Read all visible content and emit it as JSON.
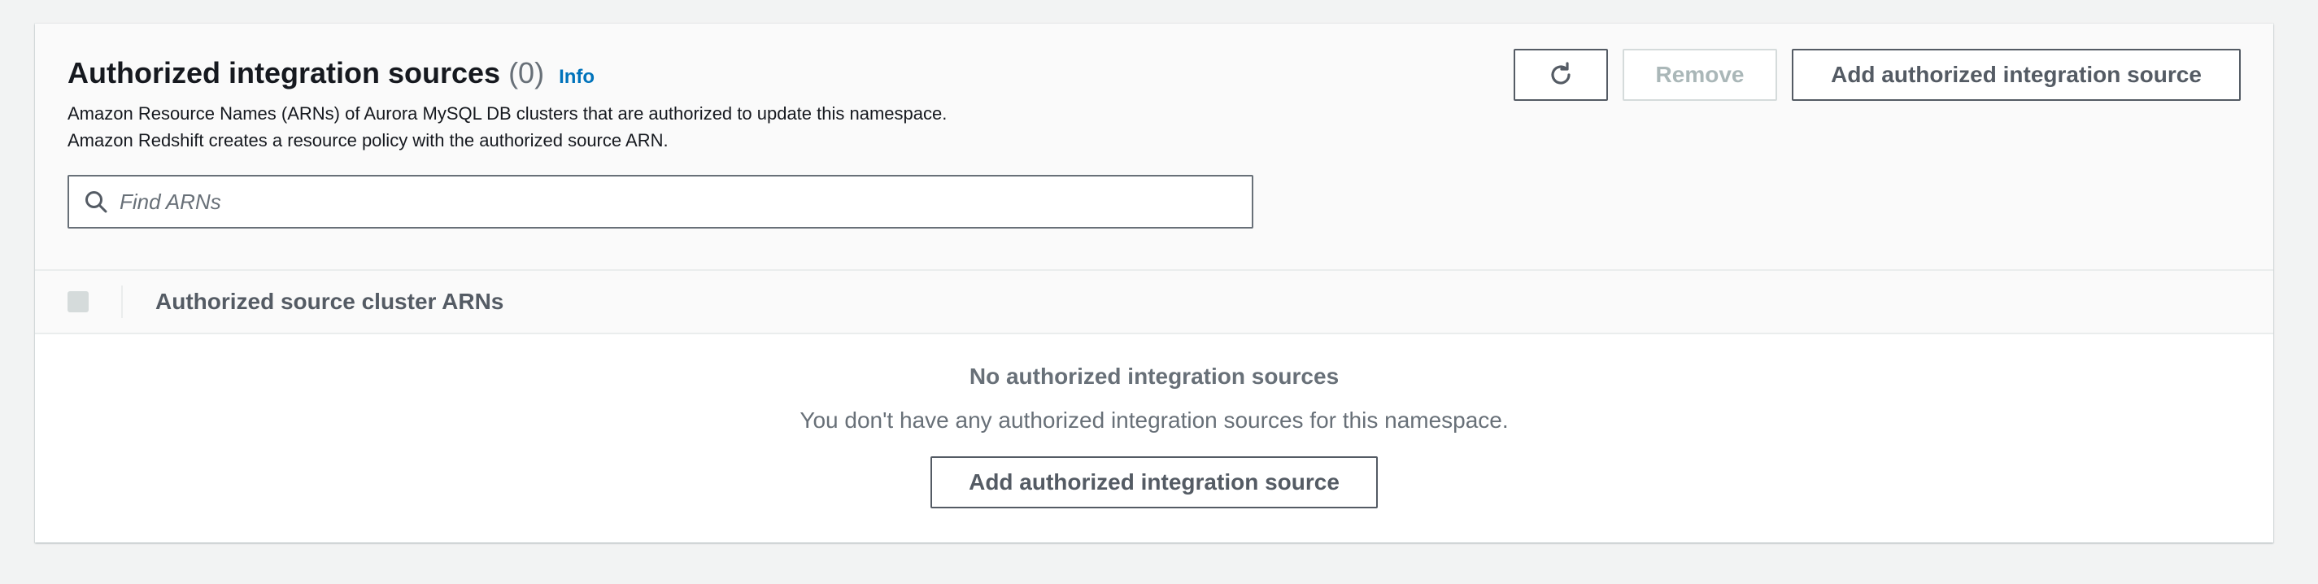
{
  "header": {
    "title": "Authorized integration sources",
    "count": "(0)",
    "info_link": "Info",
    "description_line1": "Amazon Resource Names (ARNs) of Aurora MySQL DB clusters that are authorized to update this namespace.",
    "description_line2": "Amazon Redshift creates a resource policy with the authorized source ARN."
  },
  "actions": {
    "refresh_icon": "refresh-icon",
    "remove_label": "Remove",
    "add_label": "Add authorized integration source"
  },
  "search": {
    "placeholder": "Find ARNs",
    "value": "",
    "icon": "search-icon"
  },
  "table": {
    "columns": [
      "Authorized source cluster ARNs"
    ],
    "rows": []
  },
  "empty_state": {
    "title": "No authorized integration sources",
    "description": "You don't have any authorized integration sources for this namespace.",
    "button_label": "Add authorized integration source"
  },
  "colors": {
    "link": "#0073bb",
    "text": "#16191f",
    "muted": "#687078",
    "button_border": "#545b64",
    "disabled": "#aab7b8"
  }
}
